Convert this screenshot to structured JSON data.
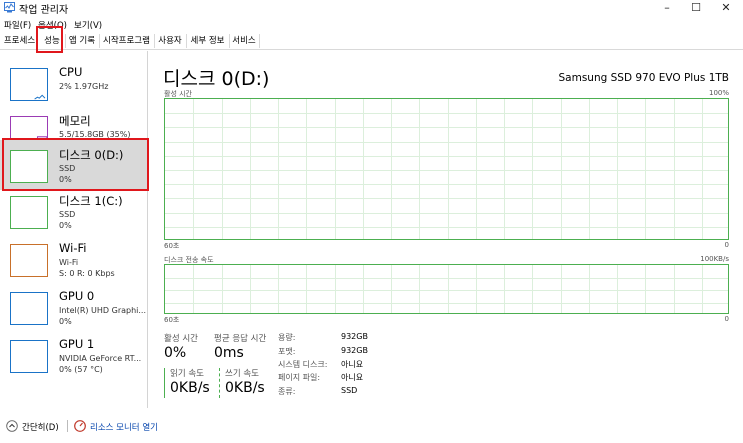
{
  "window": {
    "title": "작업 관리자",
    "minimize": "–",
    "maximize": "☐",
    "close": "✕"
  },
  "menu": [
    "파일(F)",
    "옵션(O)",
    "보기(V)"
  ],
  "tabs": [
    "프로세스",
    "성능",
    "앱 기록",
    "시작프로그램",
    "사용자",
    "세부 정보",
    "서비스"
  ],
  "active_tab": "성능",
  "sidebar": {
    "items": [
      {
        "name": "CPU",
        "sub1": "2% 1.97GHz",
        "sub2": "",
        "color": "#1a73c7"
      },
      {
        "name": "메모리",
        "sub1": "5.5/15.8GB (35%)",
        "sub2": "",
        "color": "#9b3bb4"
      },
      {
        "name": "디스크 0(D:)",
        "sub1": "SSD",
        "sub2": "0%",
        "color": "#4caf50"
      },
      {
        "name": "디스크 1(C:)",
        "sub1": "SSD",
        "sub2": "0%",
        "color": "#4caf50"
      },
      {
        "name": "Wi-Fi",
        "sub1": "Wi-Fi",
        "sub2": "S: 0 R: 0 Kbps",
        "color": "#c8702a"
      },
      {
        "name": "GPU 0",
        "sub1": "Intel(R) UHD Graphi...",
        "sub2": "0%",
        "color": "#1a73c7"
      },
      {
        "name": "GPU 1",
        "sub1": "NVIDIA GeForce RT...",
        "sub2": "0% (57 °C)",
        "color": "#1a73c7"
      }
    ],
    "selected": 2
  },
  "main": {
    "title": "디스크 0(D:)",
    "model": "Samsung SSD 970 EVO Plus 1TB",
    "graph1": {
      "label": "활성 시간",
      "max": "100%",
      "time": "60초",
      "min": "0"
    },
    "graph2": {
      "label": "디스크 전송 속도",
      "max": "100KB/s",
      "time": "60초",
      "min": "0"
    },
    "stats": {
      "active_time_label": "활성 시간",
      "active_time": "0%",
      "response_label": "평균 응답 시간",
      "response": "0ms",
      "read_label": "읽기 속도",
      "read": "0KB/s",
      "write_label": "쓰기 속도",
      "write": "0KB/s"
    },
    "info": [
      {
        "label": "용량:",
        "value": "932GB"
      },
      {
        "label": "포맷:",
        "value": "932GB"
      },
      {
        "label": "시스템 디스크:",
        "value": "아니요"
      },
      {
        "label": "페이지 파일:",
        "value": "아니요"
      },
      {
        "label": "종류:",
        "value": "SSD"
      }
    ]
  },
  "footer": {
    "collapse": "간단히(D)",
    "resource_monitor": "리소스 모니터 열기"
  },
  "colors": {
    "accent_green": "#4caf50",
    "selected_bg": "#cce4f7",
    "annotation_red": "#e0171c"
  }
}
